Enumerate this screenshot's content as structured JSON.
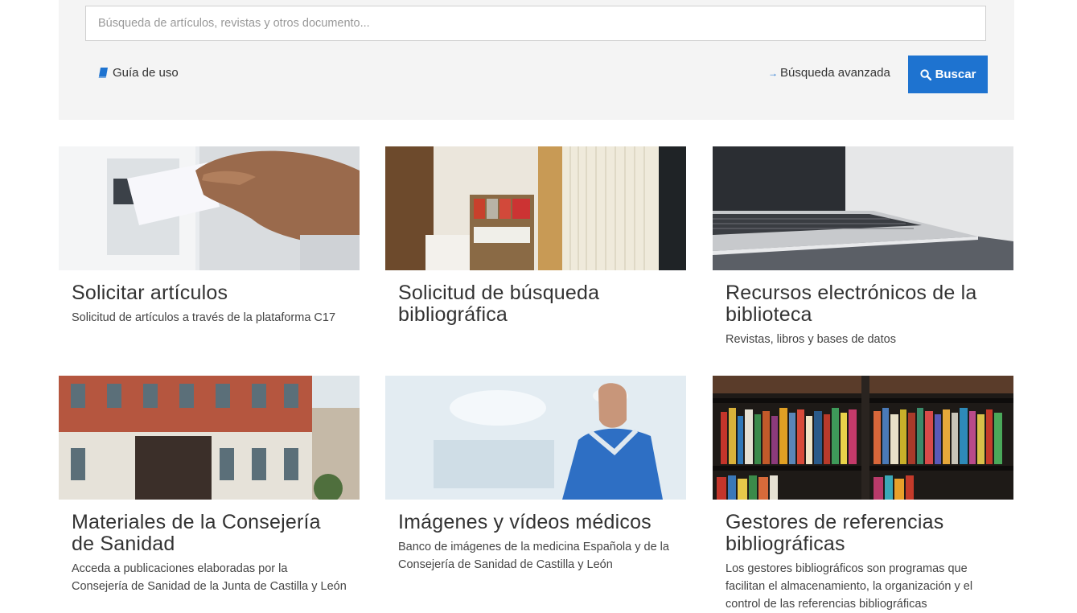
{
  "search": {
    "placeholder": "Búsqueda de artículos, revistas y otros documento...",
    "guide_label": "Guía de uso",
    "advanced_label": "Búsqueda avanzada",
    "button_label": "Buscar"
  },
  "colors": {
    "accent": "#1e73d0",
    "panel_bg": "#f4f4f4"
  },
  "cards": [
    {
      "title": "Solicitar artículos",
      "description": "Solicitud de artículos a través de la plataforma C17",
      "image": "hand-inserting-paper-image"
    },
    {
      "title": "Solicitud de búsqueda bibliográfica",
      "description": "",
      "image": "library-shelves-image"
    },
    {
      "title": "Recursos electrónicos de la biblioteca",
      "description": "Revistas, libros y bases de datos",
      "image": "laptop-image"
    },
    {
      "title": "Materiales de la Consejería de Sanidad",
      "description": "Acceda a publicaciones elaboradas por la Consejería de Sanidad de la Junta de Castilla y León",
      "image": "government-building-image"
    },
    {
      "title": "Imágenes y vídeos médicos",
      "description": "Banco de imágenes de la medicina Española y de la Consejería de Sanidad de Castilla y León",
      "image": "surgeon-image"
    },
    {
      "title": "Gestores de referencias bibliográficas",
      "description": "Los gestores bibliográficos son programas que facilitan el almacenamiento, la organización y el control de las referencias bibliográficas",
      "image": "bookshelf-image"
    }
  ]
}
